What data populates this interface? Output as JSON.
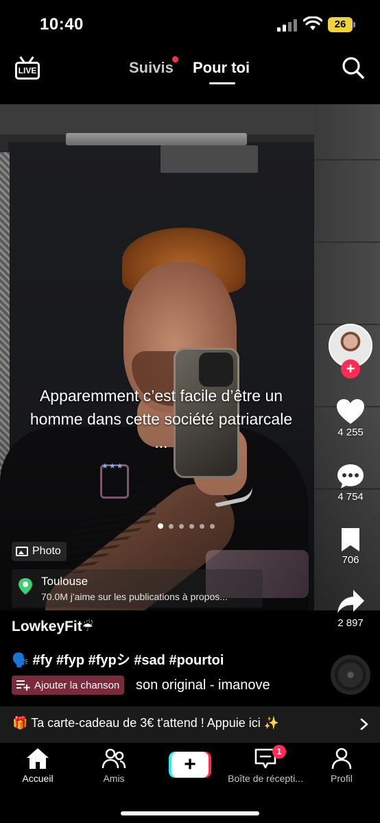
{
  "status_bar": {
    "time": "10:40",
    "battery": "26"
  },
  "header": {
    "live_label": "LIVE",
    "tab_following": "Suivis",
    "tab_for_you": "Pour toi"
  },
  "post": {
    "caption": "Apparemment c’est facile d’être un homme dans cette société patriarcale\n...",
    "slide_count": 6,
    "active_slide": 1,
    "photo_label": "Photo",
    "location": {
      "name": "Toulouse",
      "subtitle": "70.0M j'aime sur les publications à propos..."
    },
    "likes": "4 255",
    "comments": "4 754",
    "saves": "706",
    "shares": "2 897",
    "username": "LowkeyFit",
    "username_emoji": "☔",
    "desc_emoji": "🗣️",
    "hashtags": [
      "#fy",
      "#fyp",
      "#fypシ",
      "#sad",
      "#pourtoi"
    ],
    "add_song_label": "Ajouter la chanson",
    "sound": "son original - imanove"
  },
  "promo": {
    "emoji": "🎁",
    "text": "Ta carte-cadeau de 3€ t'attend ! Appuie ici",
    "sparkle": "✨"
  },
  "tabbar": {
    "home": "Accueil",
    "friends": "Amis",
    "inbox": "Boîte de récepti...",
    "inbox_badge": "1",
    "profile": "Profil"
  },
  "colors": {
    "accent": "#fe2c55",
    "cyan": "#25f4ee",
    "battery": "#f0d23a"
  },
  "icons": [
    "live-icon",
    "search-icon",
    "heart-icon",
    "comment-icon",
    "bookmark-icon",
    "share-icon",
    "home-icon",
    "friends-icon",
    "inbox-icon",
    "profile-icon",
    "pin-icon",
    "photo-icon",
    "playlist-add-icon",
    "chevron-right-icon"
  ]
}
